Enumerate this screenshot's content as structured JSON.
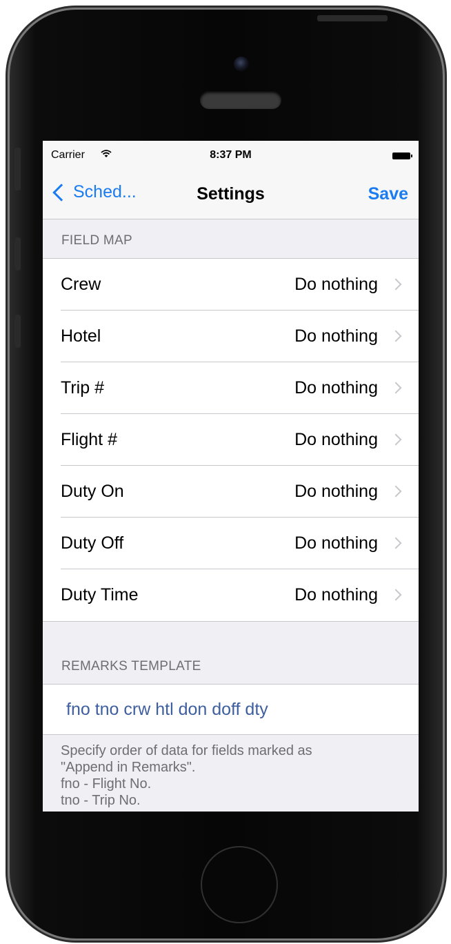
{
  "status_bar": {
    "carrier": "Carrier",
    "wifi_icon": "wifi-icon",
    "time": "8:37 PM",
    "battery_icon": "battery-icon"
  },
  "nav": {
    "back_label": "Sched...",
    "title": "Settings",
    "save_label": "Save"
  },
  "field_map": {
    "header": "FIELD MAP",
    "rows": [
      {
        "label": "Crew",
        "value": "Do nothing"
      },
      {
        "label": "Hotel",
        "value": "Do nothing"
      },
      {
        "label": "Trip #",
        "value": "Do nothing"
      },
      {
        "label": "Flight #",
        "value": "Do nothing"
      },
      {
        "label": "Duty On",
        "value": "Do nothing"
      },
      {
        "label": "Duty Off",
        "value": "Do nothing"
      },
      {
        "label": "Duty Time",
        "value": "Do nothing"
      }
    ]
  },
  "remarks": {
    "header": "REMARKS TEMPLATE",
    "template": "fno tno crw htl don doff dty",
    "footer_lines": [
      "Specify order of data for fields marked as",
      "\"Append in Remarks\".",
      "fno - Flight No.",
      "tno - Trip No."
    ]
  },
  "colors": {
    "accent": "#1a7cf0",
    "template_text": "#3d5fa0",
    "background": "#efeff4"
  }
}
